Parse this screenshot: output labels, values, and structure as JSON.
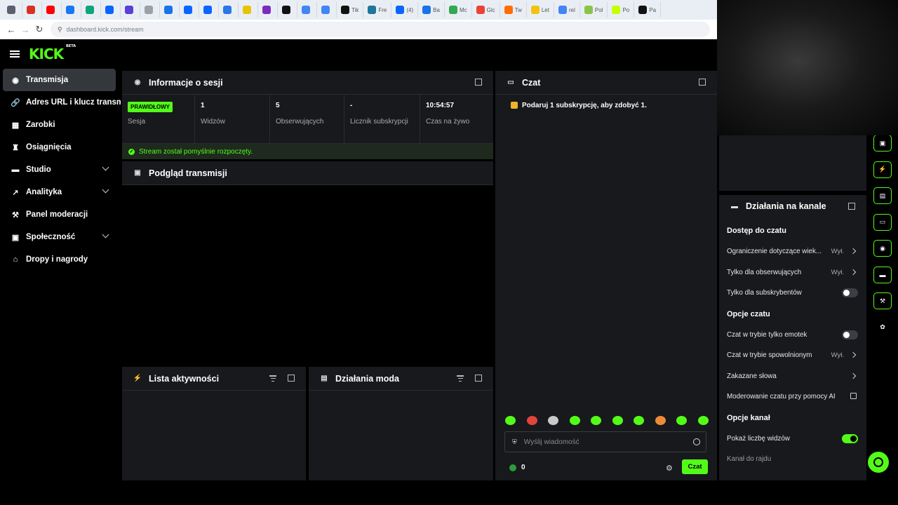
{
  "browser": {
    "tabs": [
      {
        "label": "",
        "icon": "chevron-down-icon",
        "color": "#5a6270"
      },
      {
        "label": "",
        "icon": "gmail-icon",
        "color": "#d93025"
      },
      {
        "label": "",
        "icon": "youtube-icon",
        "color": "#ff0000"
      },
      {
        "label": "",
        "icon": "facebook-icon",
        "color": "#1877f2"
      },
      {
        "label": "",
        "icon": "site-icon",
        "color": "#10a37f"
      },
      {
        "label": "",
        "icon": "meta-icon",
        "color": "#0866ff"
      },
      {
        "label": "",
        "icon": "site-icon",
        "color": "#5b3fd6"
      },
      {
        "label": "",
        "icon": "site-icon",
        "color": "#9aa0a6"
      },
      {
        "label": "",
        "icon": "site-icon",
        "color": "#1a73e8"
      },
      {
        "label": "",
        "icon": "meta-icon",
        "color": "#0866ff"
      },
      {
        "label": "",
        "icon": "meta-icon",
        "color": "#0866ff"
      },
      {
        "label": "",
        "icon": "site-icon",
        "color": "#2b78e4"
      },
      {
        "label": "",
        "icon": "play-icon",
        "color": "#e8c400"
      },
      {
        "label": "",
        "icon": "site-icon",
        "color": "#7b2cbf"
      },
      {
        "label": "",
        "icon": "site-icon",
        "color": "#111111"
      },
      {
        "label": "",
        "icon": "google-icon",
        "color": "#4285f4"
      },
      {
        "label": "",
        "icon": "google-icon",
        "color": "#4285f4"
      },
      {
        "label": "Tik",
        "icon": "tiktok-icon",
        "color": "#111111"
      },
      {
        "label": "Fre",
        "icon": "wordpress-icon",
        "color": "#21759b"
      },
      {
        "label": "(4)",
        "icon": "meta-icon",
        "color": "#0866ff"
      },
      {
        "label": "Ba",
        "icon": "site-icon",
        "color": "#1a73e8"
      },
      {
        "label": "Mc",
        "icon": "maps-icon",
        "color": "#34a853"
      },
      {
        "label": "Glc",
        "icon": "site-icon",
        "color": "#ea4335"
      },
      {
        "label": "Tw",
        "icon": "site-icon",
        "color": "#ff6d00"
      },
      {
        "label": "Let",
        "icon": "site-icon",
        "color": "#f4c20d"
      },
      {
        "label": "rel",
        "icon": "google-icon",
        "color": "#4285f4"
      },
      {
        "label": "Pol",
        "icon": "site-icon",
        "color": "#8bc34a"
      },
      {
        "label": "Po",
        "icon": "site-icon",
        "color": "#c6ff00"
      },
      {
        "label": "Pa",
        "icon": "site-icon",
        "color": "#111111"
      }
    ],
    "url": "dashboard.kick.com/stream"
  },
  "app": {
    "logo": "KICK",
    "logo_tag": "BETA"
  },
  "sidebar": {
    "items": [
      {
        "label": "Transmisja",
        "icon": "broadcast-icon",
        "glyph": "◉",
        "active": true,
        "expandable": false
      },
      {
        "label": "Adres URL i klucz transmisji",
        "icon": "link-icon",
        "glyph": "🔗",
        "active": false,
        "expandable": false
      },
      {
        "label": "Zarobki",
        "icon": "earnings-icon",
        "glyph": "▦",
        "active": false,
        "expandable": false
      },
      {
        "label": "Osiągnięcia",
        "icon": "trophy-icon",
        "glyph": "♜",
        "active": false,
        "expandable": false
      },
      {
        "label": "Studio",
        "icon": "studio-icon",
        "glyph": "▬",
        "active": false,
        "expandable": true
      },
      {
        "label": "Analityka",
        "icon": "analytics-icon",
        "glyph": "↗",
        "active": false,
        "expandable": true
      },
      {
        "label": "Panel moderacji",
        "icon": "wrench-icon",
        "glyph": "⚒",
        "active": false,
        "expandable": false
      },
      {
        "label": "Społeczność",
        "icon": "community-icon",
        "glyph": "▣",
        "active": false,
        "expandable": true
      },
      {
        "label": "Dropy i nagrody",
        "icon": "gift-icon",
        "glyph": "⌂",
        "active": false,
        "expandable": false
      }
    ]
  },
  "session": {
    "title": "Informacje o sesji",
    "stats": [
      {
        "value": "",
        "badge": "PRAWIDŁOWY",
        "label": "Sesja"
      },
      {
        "value": "1",
        "badge": "",
        "label": "Widzów"
      },
      {
        "value": "5",
        "badge": "",
        "label": "Obserwujących"
      },
      {
        "value": "-",
        "badge": "",
        "label": "Licznik subskrypcji"
      },
      {
        "value": "10:54:57",
        "badge": "",
        "label": "Czas na żywo"
      }
    ],
    "status_message": "Stream został pomyślnie rozpoczęty."
  },
  "preview": {
    "title": "Podgląd transmisji"
  },
  "activity": {
    "title": "Lista aktywności"
  },
  "mod_actions": {
    "title": "Działania moda"
  },
  "chat": {
    "title": "Czat",
    "gift_message": "Podaruj 1 subskrypcję, aby zdobyć 1.",
    "input_placeholder": "Wyślij wiadomość",
    "count": "0",
    "send_label": "Czat",
    "emote_count": 10
  },
  "channel_actions": {
    "title": "Działania na kanale",
    "sections": [
      {
        "title": "Dostęp do czatu",
        "rows": [
          {
            "label": "Ograniczenie dotyczące wiek...",
            "value": "Wył.",
            "control": "chevron"
          },
          {
            "label": "Tylko dla obserwujących",
            "value": "Wył.",
            "control": "chevron"
          },
          {
            "label": "Tylko dla subskrybentów",
            "value": "",
            "control": "toggle-off"
          }
        ]
      },
      {
        "title": "Opcje czatu",
        "rows": [
          {
            "label": "Czat w trybie tylko emotek",
            "value": "",
            "control": "toggle-off"
          },
          {
            "label": "Czat w trybie spowolnionym",
            "value": "Wył.",
            "control": "chevron"
          },
          {
            "label": "Zakazane słowa",
            "value": "",
            "control": "chevron"
          },
          {
            "label": "Moderowanie czatu przy pomocy AI",
            "value": "",
            "control": "external"
          }
        ]
      },
      {
        "title": "Opcje kanał",
        "rows": [
          {
            "label": "Pokaż liczbę widzów",
            "value": "",
            "control": "toggle-on"
          },
          {
            "label": "Kanał do rajdu",
            "value": "",
            "control": "none"
          }
        ]
      }
    ]
  },
  "rail": {
    "buttons": [
      "video-icon",
      "bolt-icon",
      "list-icon",
      "chat-icon",
      "broadcast-icon",
      "channel-icon",
      "wrench-icon",
      "community-icon"
    ]
  },
  "colors": {
    "accent": "#53fc18",
    "panel": "#18191c",
    "background": "#000000"
  }
}
